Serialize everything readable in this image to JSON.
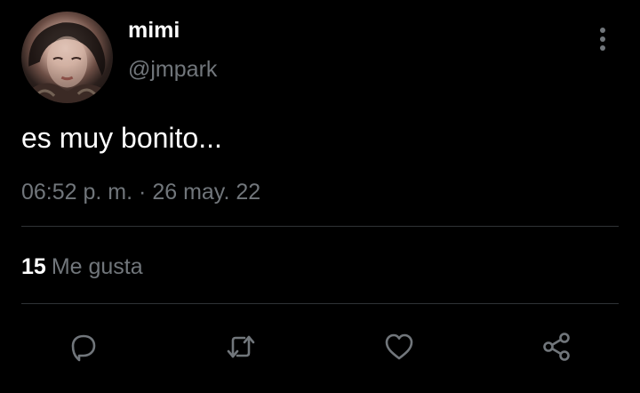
{
  "tweet": {
    "author": {
      "display_name": "mimi",
      "handle": "@jmpark"
    },
    "text": "es muy bonito...",
    "time": "06:52 p. m.",
    "separator": "·",
    "date": "26 may. 22",
    "likes_count": "15",
    "likes_label": "Me gusta"
  },
  "icons": {
    "more": "more-vertical-icon",
    "reply": "reply-icon",
    "retweet": "retweet-icon",
    "like": "heart-icon",
    "share": "share-icon"
  },
  "colors": {
    "background": "#000000",
    "text_primary": "#ffffff",
    "text_secondary": "#71767b",
    "divider": "#2f3336"
  }
}
